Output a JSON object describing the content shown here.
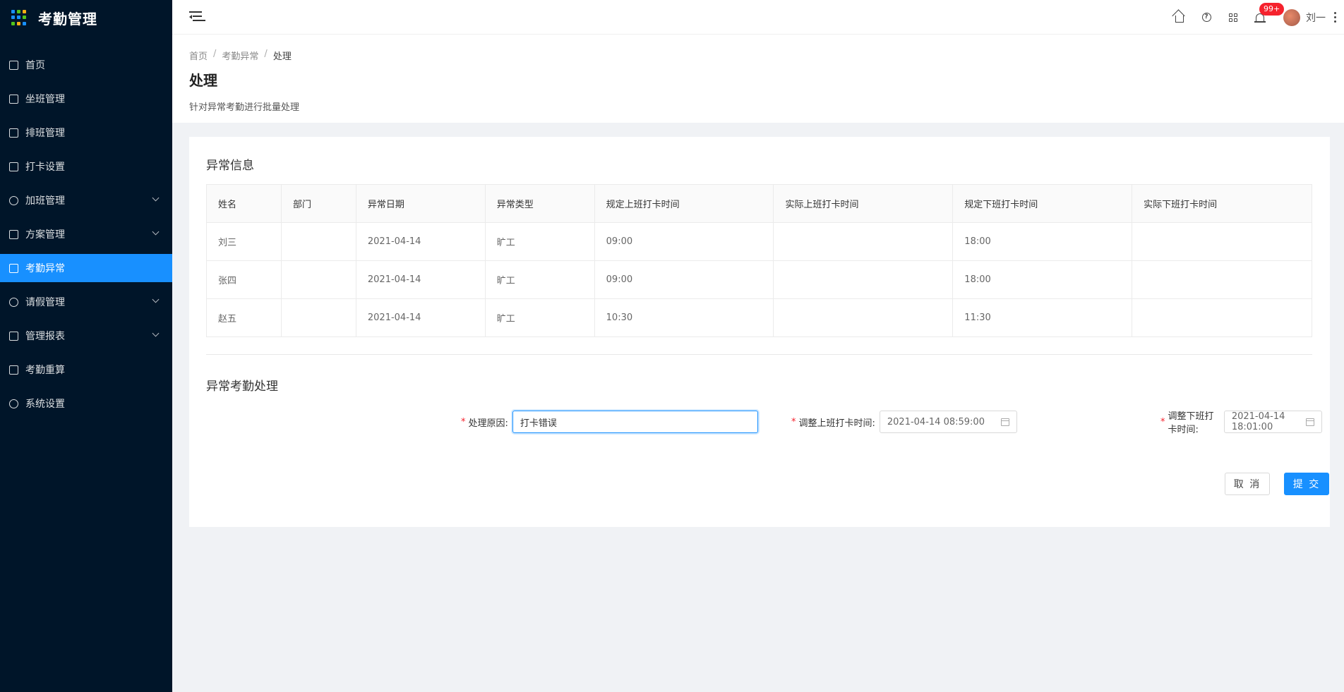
{
  "app": {
    "title": "考勤管理"
  },
  "sidebar": {
    "items": [
      {
        "label": "首页"
      },
      {
        "label": "坐班管理"
      },
      {
        "label": "排班管理"
      },
      {
        "label": "打卡设置"
      },
      {
        "label": "加班管理"
      },
      {
        "label": "方案管理"
      },
      {
        "label": "考勤异常"
      },
      {
        "label": "请假管理"
      },
      {
        "label": "管理报表"
      },
      {
        "label": "考勤重算"
      },
      {
        "label": "系统设置"
      }
    ]
  },
  "header": {
    "badge": "99+",
    "user_name": "刘一"
  },
  "breadcrumb": {
    "home": "首页",
    "parent": "考勤异常",
    "current": "处理"
  },
  "page": {
    "title": "处理",
    "description": "针对异常考勤进行批量处理"
  },
  "exception_info": {
    "title": "异常信息",
    "columns": [
      "姓名",
      "部门",
      "异常日期",
      "异常类型",
      "规定上班打卡时间",
      "实际上班打卡时间",
      "规定下班打卡时间",
      "实际下班打卡时间"
    ],
    "rows": [
      [
        "刘三",
        "",
        "2021-04-14",
        "旷工",
        "09:00",
        "",
        "18:00",
        ""
      ],
      [
        "张四",
        "",
        "2021-04-14",
        "旷工",
        "09:00",
        "",
        "18:00",
        ""
      ],
      [
        "赵五",
        "",
        "2021-04-14",
        "旷工",
        "10:30",
        "",
        "11:30",
        ""
      ]
    ]
  },
  "handling": {
    "title": "异常考勤处理",
    "reason_label": "处理原因:",
    "reason_value": "打卡错误",
    "start_label": "调整上班打卡时间:",
    "start_value": "2021-04-14 08:59:00",
    "end_label": "调整下班打卡时间:",
    "end_value": "2021-04-14 18:01:00",
    "required_mark": "*",
    "cancel": "取 消",
    "submit": "提 交"
  },
  "colors": {
    "sidebar_bg": "#001529",
    "accent": "#1890ff",
    "danger": "#f5222d"
  }
}
